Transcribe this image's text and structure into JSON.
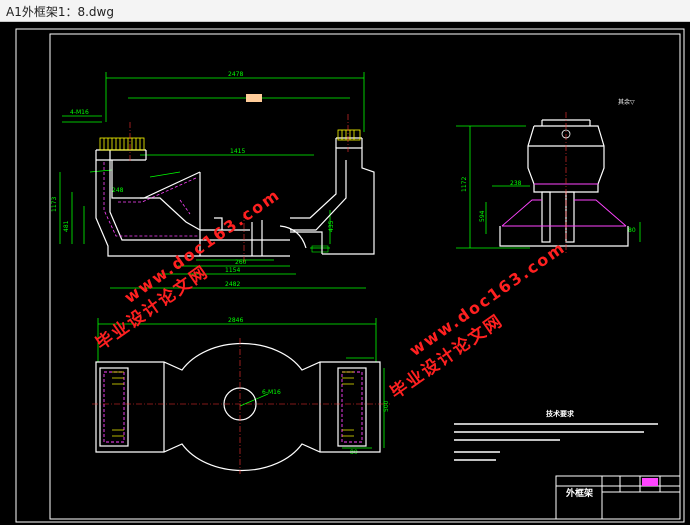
{
  "window": {
    "title": "A1外框架1：8.dwg"
  },
  "drawing": {
    "colors": {
      "background": "#000000",
      "outline": "#ffffff",
      "dimension": "#00ff00",
      "centerline": "#ff3333",
      "hidden": "#ff44ff",
      "hatch": "#ffff00",
      "watermark": "#ff2020"
    },
    "watermarks": [
      {
        "cn": "毕业设计论文网",
        "url": "www.doc163.com"
      },
      {
        "cn": "毕业设计论文网",
        "url": "www.doc163.com"
      }
    ],
    "title_block": {
      "part_name": "外框架"
    },
    "tech_notes": {
      "heading": "技术要求"
    }
  }
}
